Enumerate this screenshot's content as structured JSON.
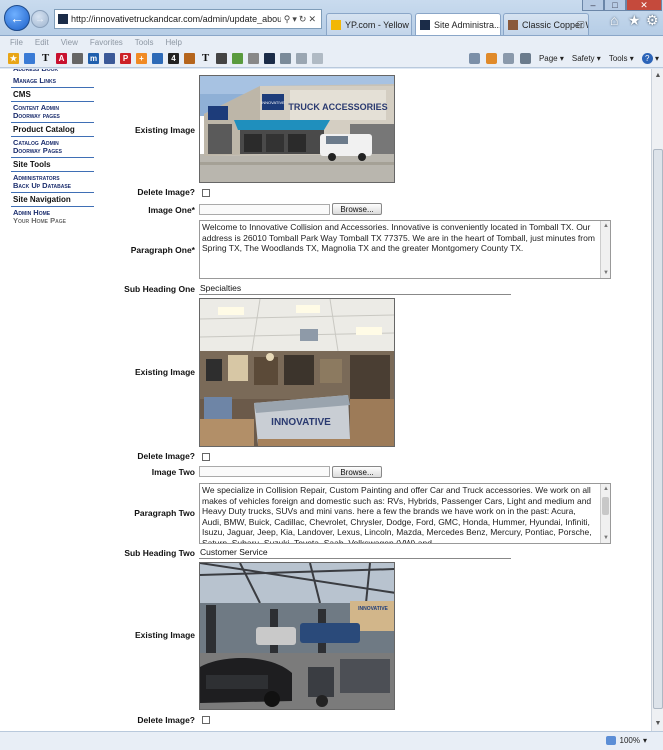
{
  "browser": {
    "url": "http://innovativetruckandcar.com/admin/update_about.a",
    "tabs": [
      {
        "label": "YP.com - Yellow P..."
      },
      {
        "label": "Site Administra..."
      },
      {
        "label": "Classic Copper W..."
      }
    ],
    "menu": [
      "File",
      "Edit",
      "View",
      "Favorites",
      "Tools",
      "Help"
    ],
    "commands": {
      "page": "Page",
      "safety": "Safety",
      "tools": "Tools"
    },
    "zoom": "100%"
  },
  "sidebar": {
    "manage_links": "Manage Links",
    "cms_heading": "CMS",
    "content_admin": "Content Admin",
    "doorway_pages_1": "Doorway pages",
    "catalog_heading": "Product Catalog",
    "catalog_admin": "Catalog Admin",
    "doorway_pages_2": "Doorway Pages",
    "tools_heading": "Site Tools",
    "administrators": "Administrators",
    "backup_db": "Back Up Database",
    "nav_heading": "Site Navigation",
    "admin_home": "Admin Home",
    "your_home": "Your Home Page"
  },
  "form": {
    "existing_image": "Existing Image",
    "delete_image": "Delete Image?",
    "image_one": "Image One*",
    "image_two": "Image Two",
    "browse": "Browse...",
    "paragraph_one_label": "Paragraph One*",
    "paragraph_one": "Welcome to Innovative Collision and Accessories. Innovative is conveniently located in Tomball TX. Our address is 26010 Tomball Park Way Tomball TX 77375. We are in the heart of Tomball, just minutes from Spring TX, The Woodlands TX, Magnolia TX and the greater Montgomery County TX.",
    "sub_heading_one_label": "Sub Heading One",
    "sub_heading_one": "Specialties",
    "paragraph_two_label": "Paragraph Two",
    "paragraph_two": "We specialize in Collision Repair, Custom Painting and offer Car and Truck accessories. We work on all makes of vehicles foreign and domestic such as: RVs, Hybrids, Passenger Cars, Light and medium and Heavy Duty trucks, SUVs and mini vans. here a few the brands we have work on in the past: Acura, Audi, BMW, Buick, Cadillac, Chevrolet, Chrysler, Dodge, Ford, GMC, Honda, Hummer, Hyundai, Infiniti, Isuzu, Jaguar, Jeep, Kia, Landover, Lexus, Lincoln, Mazda, Mercedes Benz, Mercury, Pontiac, Porsche, Saturn, Subaru, Suzuki, Toyota, Saab, Volkswagen (VW) and",
    "sub_heading_two_label": "Sub Heading Two",
    "sub_heading_two": "Customer Service"
  },
  "images": {
    "storefront_sign": "TRUCK ACCESSORIES",
    "storefront_brand": "INNOVATIVE",
    "interior_brand": "INNOVATIVE",
    "shop_brand": "INNOVATIVE"
  }
}
